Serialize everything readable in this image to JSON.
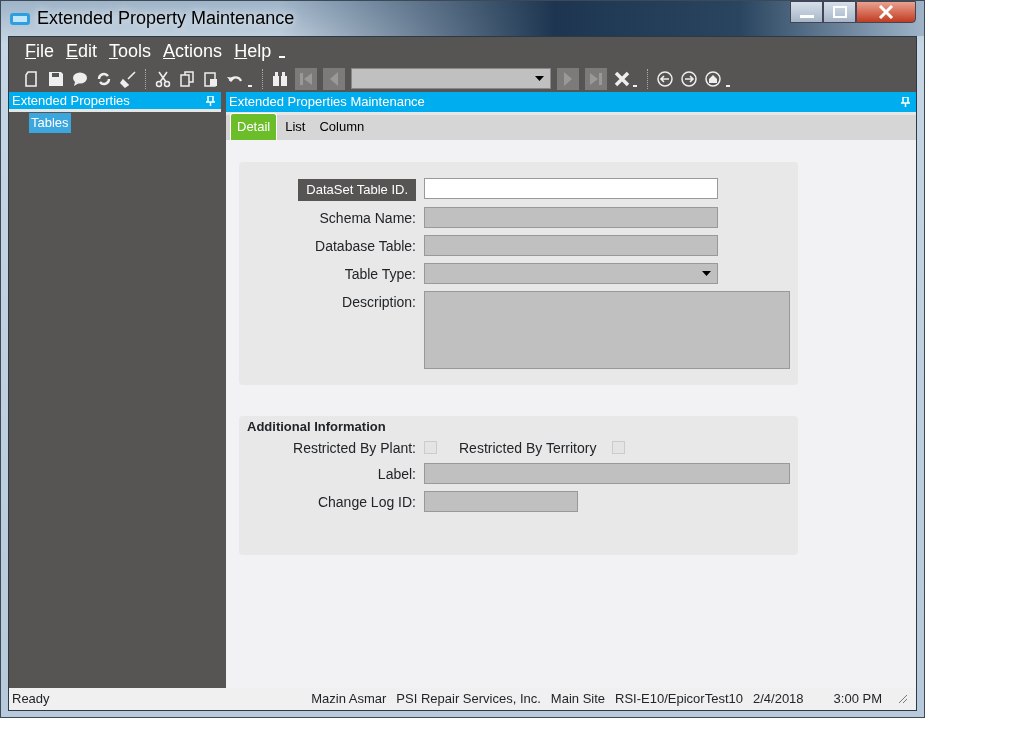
{
  "window": {
    "title": "Extended Property Maintenance"
  },
  "menu": [
    {
      "label": "File"
    },
    {
      "label": "Edit"
    },
    {
      "label": "Tools"
    },
    {
      "label": "Actions"
    },
    {
      "label": "Help"
    }
  ],
  "nav_panel": {
    "title": "Extended Properties",
    "items": [
      {
        "label": "Tables",
        "selected": true
      }
    ]
  },
  "main_panel": {
    "title": "Extended Properties Maintenance",
    "tabs": [
      {
        "label": "Detail",
        "selected": true
      },
      {
        "label": "List",
        "selected": false
      },
      {
        "label": "Column",
        "selected": false
      }
    ],
    "fields": [
      {
        "label": "DataSet Table ID.",
        "kind": "text",
        "highlighted": true,
        "disabled": false
      },
      {
        "label": "Schema Name:",
        "kind": "text",
        "highlighted": false,
        "disabled": true
      },
      {
        "label": "Database Table:",
        "kind": "text",
        "highlighted": false,
        "disabled": true
      },
      {
        "label": "Table Type:",
        "kind": "dropdown",
        "highlighted": false,
        "disabled": true
      },
      {
        "label": "Description:",
        "kind": "memo",
        "highlighted": false,
        "disabled": true
      }
    ],
    "additional": {
      "title": "Additional Information",
      "checkboxes": [
        {
          "label": "Restricted By Plant:",
          "checked": false,
          "disabled": true
        },
        {
          "label": "Restricted By Territory",
          "checked": false,
          "disabled": true
        }
      ],
      "fields": [
        {
          "label": "Label:",
          "kind": "wide",
          "disabled": true
        },
        {
          "label": "Change Log ID:",
          "kind": "short",
          "disabled": true
        }
      ]
    }
  },
  "status_bar": [
    "Ready",
    "Mazin Asmar",
    "PSI Repair Services, Inc.",
    "Main Site",
    "RSI-E10/EpicorTest10",
    "2/4/2018",
    "3:00 PM"
  ]
}
